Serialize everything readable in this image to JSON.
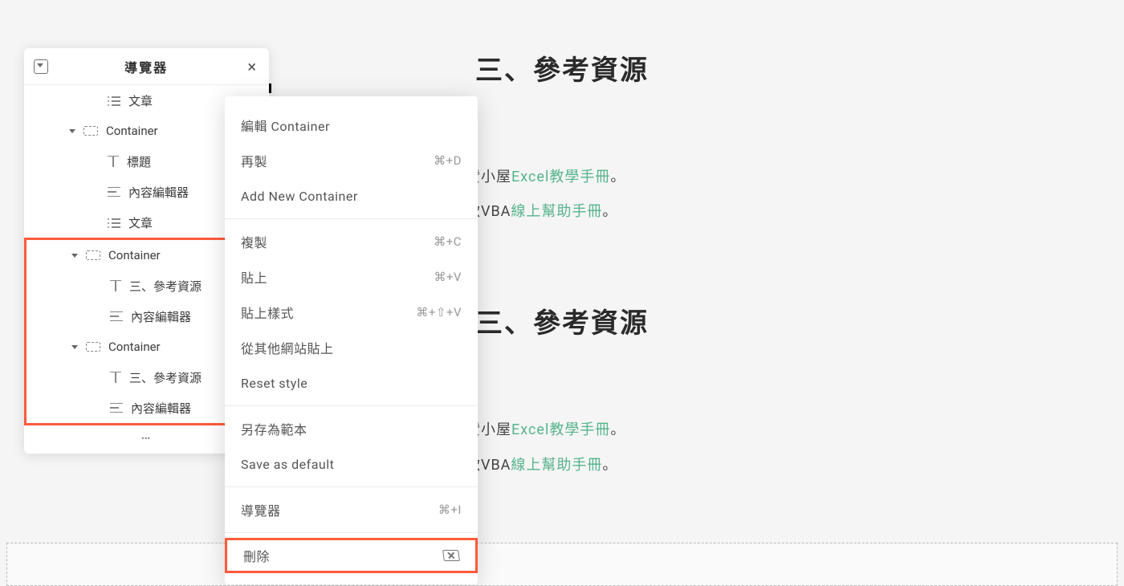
{
  "page": {
    "sections": [
      {
        "heading": "三、參考資源",
        "lines": [
          {
            "prefix": "贊小屋",
            "link_text": "Excel教學手冊",
            "suffix": "。"
          },
          {
            "prefix": "軟VBA",
            "link_text": "線上幫助手冊",
            "suffix": "。"
          }
        ]
      },
      {
        "heading": "三、參考資源",
        "lines": [
          {
            "prefix": "贊小屋",
            "link_text": "Excel教學手冊",
            "suffix": "。"
          },
          {
            "prefix": "軟VBA",
            "link_text": "線上幫助手冊",
            "suffix": "。"
          }
        ]
      }
    ]
  },
  "navigator": {
    "title": "導覽器",
    "more": "…",
    "items": [
      {
        "level": 2,
        "icon": "posts",
        "label": "文章",
        "toggle": false,
        "partial": true
      },
      {
        "level": 1,
        "icon": "container",
        "label": "Container",
        "toggle": true
      },
      {
        "level": 2,
        "icon": "heading",
        "label": "標題",
        "toggle": false
      },
      {
        "level": 2,
        "icon": "text",
        "label": "內容編輯器",
        "toggle": false
      },
      {
        "level": 2,
        "icon": "posts",
        "label": "文章",
        "toggle": false
      },
      {
        "level": 1,
        "icon": "container",
        "label": "Container",
        "toggle": true,
        "boxed": "start"
      },
      {
        "level": 2,
        "icon": "heading",
        "label": "三、參考資源",
        "toggle": false
      },
      {
        "level": 2,
        "icon": "text",
        "label": "內容編輯器",
        "toggle": false
      },
      {
        "level": 1,
        "icon": "container",
        "label": "Container",
        "toggle": true
      },
      {
        "level": 2,
        "icon": "heading",
        "label": "三、參考資源",
        "toggle": false
      },
      {
        "level": 2,
        "icon": "text",
        "label": "內容編輯器",
        "toggle": false,
        "boxed": "end"
      }
    ]
  },
  "context_menu": {
    "groups": [
      [
        {
          "label": "編輯 Container",
          "shortcut": ""
        },
        {
          "label": "再製",
          "shortcut": "⌘+D"
        },
        {
          "label": "Add New Container",
          "shortcut": ""
        }
      ],
      [
        {
          "label": "複製",
          "shortcut": "⌘+C"
        },
        {
          "label": "貼上",
          "shortcut": "⌘+V"
        },
        {
          "label": "貼上樣式",
          "shortcut": "⌘+⇧+V"
        },
        {
          "label": "從其他網站貼上",
          "shortcut": ""
        },
        {
          "label": "Reset style",
          "shortcut": ""
        }
      ],
      [
        {
          "label": "另存為範本",
          "shortcut": ""
        },
        {
          "label": "Save as default",
          "shortcut": ""
        }
      ],
      [
        {
          "label": "導覽器",
          "shortcut": "⌘+I"
        }
      ],
      [
        {
          "label": "刪除",
          "shortcut": "",
          "delete_icon": true,
          "highlighted": true
        }
      ]
    ]
  }
}
